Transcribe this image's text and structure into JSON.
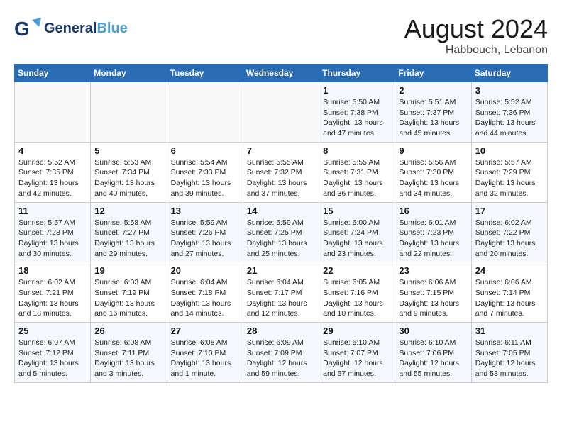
{
  "header": {
    "logo_general": "General",
    "logo_blue": "Blue",
    "month_year": "August 2024",
    "location": "Habbouch, Lebanon"
  },
  "weekdays": [
    "Sunday",
    "Monday",
    "Tuesday",
    "Wednesday",
    "Thursday",
    "Friday",
    "Saturday"
  ],
  "weeks": [
    [
      {
        "day": "",
        "info": ""
      },
      {
        "day": "",
        "info": ""
      },
      {
        "day": "",
        "info": ""
      },
      {
        "day": "",
        "info": ""
      },
      {
        "day": "1",
        "info": "Sunrise: 5:50 AM\nSunset: 7:38 PM\nDaylight: 13 hours\nand 47 minutes."
      },
      {
        "day": "2",
        "info": "Sunrise: 5:51 AM\nSunset: 7:37 PM\nDaylight: 13 hours\nand 45 minutes."
      },
      {
        "day": "3",
        "info": "Sunrise: 5:52 AM\nSunset: 7:36 PM\nDaylight: 13 hours\nand 44 minutes."
      }
    ],
    [
      {
        "day": "4",
        "info": "Sunrise: 5:52 AM\nSunset: 7:35 PM\nDaylight: 13 hours\nand 42 minutes."
      },
      {
        "day": "5",
        "info": "Sunrise: 5:53 AM\nSunset: 7:34 PM\nDaylight: 13 hours\nand 40 minutes."
      },
      {
        "day": "6",
        "info": "Sunrise: 5:54 AM\nSunset: 7:33 PM\nDaylight: 13 hours\nand 39 minutes."
      },
      {
        "day": "7",
        "info": "Sunrise: 5:55 AM\nSunset: 7:32 PM\nDaylight: 13 hours\nand 37 minutes."
      },
      {
        "day": "8",
        "info": "Sunrise: 5:55 AM\nSunset: 7:31 PM\nDaylight: 13 hours\nand 36 minutes."
      },
      {
        "day": "9",
        "info": "Sunrise: 5:56 AM\nSunset: 7:30 PM\nDaylight: 13 hours\nand 34 minutes."
      },
      {
        "day": "10",
        "info": "Sunrise: 5:57 AM\nSunset: 7:29 PM\nDaylight: 13 hours\nand 32 minutes."
      }
    ],
    [
      {
        "day": "11",
        "info": "Sunrise: 5:57 AM\nSunset: 7:28 PM\nDaylight: 13 hours\nand 30 minutes."
      },
      {
        "day": "12",
        "info": "Sunrise: 5:58 AM\nSunset: 7:27 PM\nDaylight: 13 hours\nand 29 minutes."
      },
      {
        "day": "13",
        "info": "Sunrise: 5:59 AM\nSunset: 7:26 PM\nDaylight: 13 hours\nand 27 minutes."
      },
      {
        "day": "14",
        "info": "Sunrise: 5:59 AM\nSunset: 7:25 PM\nDaylight: 13 hours\nand 25 minutes."
      },
      {
        "day": "15",
        "info": "Sunrise: 6:00 AM\nSunset: 7:24 PM\nDaylight: 13 hours\nand 23 minutes."
      },
      {
        "day": "16",
        "info": "Sunrise: 6:01 AM\nSunset: 7:23 PM\nDaylight: 13 hours\nand 22 minutes."
      },
      {
        "day": "17",
        "info": "Sunrise: 6:02 AM\nSunset: 7:22 PM\nDaylight: 13 hours\nand 20 minutes."
      }
    ],
    [
      {
        "day": "18",
        "info": "Sunrise: 6:02 AM\nSunset: 7:21 PM\nDaylight: 13 hours\nand 18 minutes."
      },
      {
        "day": "19",
        "info": "Sunrise: 6:03 AM\nSunset: 7:19 PM\nDaylight: 13 hours\nand 16 minutes."
      },
      {
        "day": "20",
        "info": "Sunrise: 6:04 AM\nSunset: 7:18 PM\nDaylight: 13 hours\nand 14 minutes."
      },
      {
        "day": "21",
        "info": "Sunrise: 6:04 AM\nSunset: 7:17 PM\nDaylight: 13 hours\nand 12 minutes."
      },
      {
        "day": "22",
        "info": "Sunrise: 6:05 AM\nSunset: 7:16 PM\nDaylight: 13 hours\nand 10 minutes."
      },
      {
        "day": "23",
        "info": "Sunrise: 6:06 AM\nSunset: 7:15 PM\nDaylight: 13 hours\nand 9 minutes."
      },
      {
        "day": "24",
        "info": "Sunrise: 6:06 AM\nSunset: 7:14 PM\nDaylight: 13 hours\nand 7 minutes."
      }
    ],
    [
      {
        "day": "25",
        "info": "Sunrise: 6:07 AM\nSunset: 7:12 PM\nDaylight: 13 hours\nand 5 minutes."
      },
      {
        "day": "26",
        "info": "Sunrise: 6:08 AM\nSunset: 7:11 PM\nDaylight: 13 hours\nand 3 minutes."
      },
      {
        "day": "27",
        "info": "Sunrise: 6:08 AM\nSunset: 7:10 PM\nDaylight: 13 hours\nand 1 minute."
      },
      {
        "day": "28",
        "info": "Sunrise: 6:09 AM\nSunset: 7:09 PM\nDaylight: 12 hours\nand 59 minutes."
      },
      {
        "day": "29",
        "info": "Sunrise: 6:10 AM\nSunset: 7:07 PM\nDaylight: 12 hours\nand 57 minutes."
      },
      {
        "day": "30",
        "info": "Sunrise: 6:10 AM\nSunset: 7:06 PM\nDaylight: 12 hours\nand 55 minutes."
      },
      {
        "day": "31",
        "info": "Sunrise: 6:11 AM\nSunset: 7:05 PM\nDaylight: 12 hours\nand 53 minutes."
      }
    ]
  ]
}
